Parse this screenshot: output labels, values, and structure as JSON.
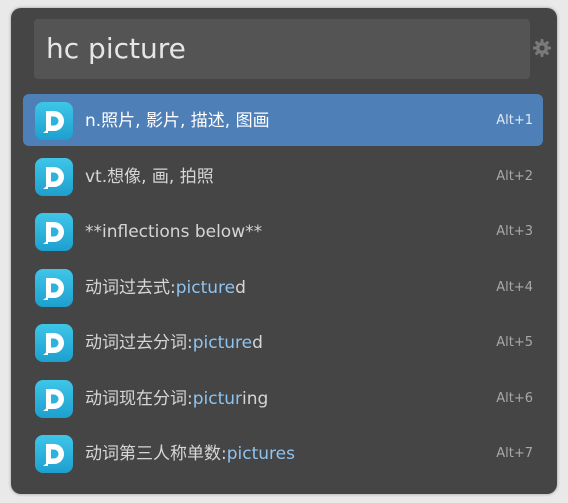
{
  "search": {
    "query": "hc picture"
  },
  "icons": {
    "settings": "gear-icon",
    "result": "dictionary-app-icon"
  },
  "colors": {
    "window_bg": "#454545",
    "selection": "#4e7fb7",
    "highlight": "#8fc3f0",
    "icon_accent": "#2bb3de"
  },
  "results": [
    {
      "prefix": "n.照片, 影片, 描述, 图画",
      "highlight": "",
      "suffix": "",
      "shortcut": "Alt+1",
      "selected": true
    },
    {
      "prefix": "vt.想像, 画, 拍照",
      "highlight": "",
      "suffix": "",
      "shortcut": "Alt+2",
      "selected": false
    },
    {
      "prefix": "**inflections below**",
      "highlight": "",
      "suffix": "",
      "shortcut": "Alt+3",
      "selected": false
    },
    {
      "prefix": "动词过去式:",
      "highlight": "picture",
      "suffix": "d",
      "shortcut": "Alt+4",
      "selected": false
    },
    {
      "prefix": "动词过去分词:",
      "highlight": "picture",
      "suffix": "d",
      "shortcut": "Alt+5",
      "selected": false
    },
    {
      "prefix": "动词现在分词:",
      "highlight": "pictur",
      "suffix": "ing",
      "shortcut": "Alt+6",
      "selected": false
    },
    {
      "prefix": "动词第三人称单数:",
      "highlight": "pictures",
      "suffix": "",
      "shortcut": "Alt+7",
      "selected": false
    }
  ]
}
